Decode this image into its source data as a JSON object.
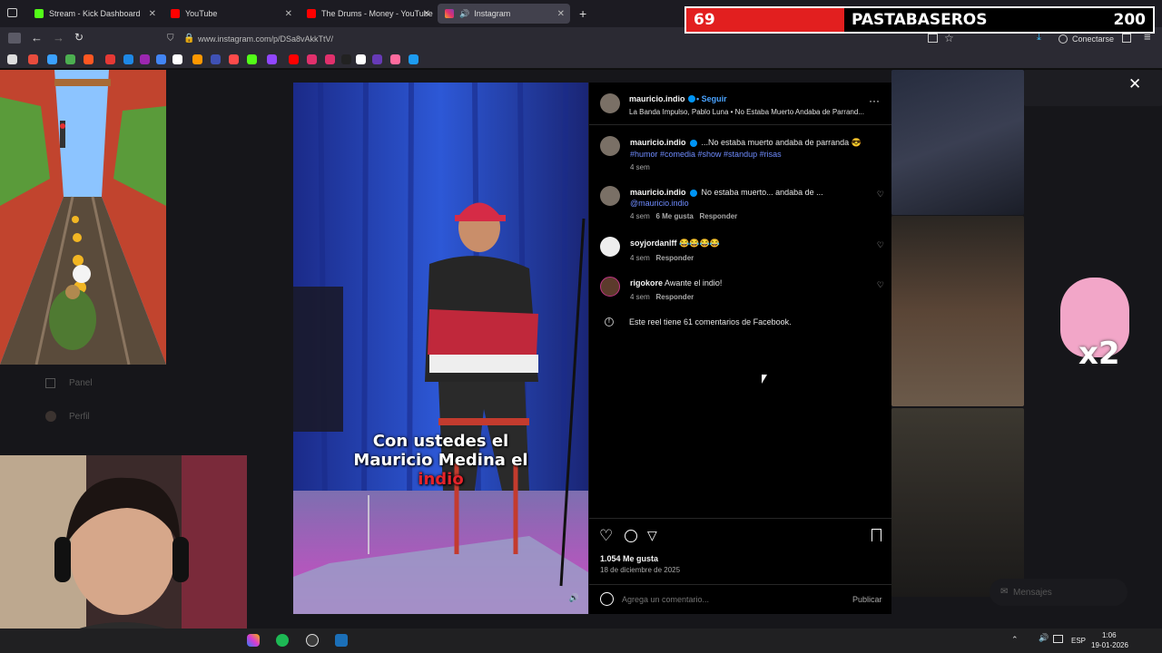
{
  "browser": {
    "tabs": [
      {
        "title": "Stream - Kick Dashboard",
        "color": "#53fc18"
      },
      {
        "title": "YouTube",
        "color": "#ff0000"
      },
      {
        "title": "The Drums - Money - YouTube",
        "color": "#ff0000"
      },
      {
        "title": "Instagram",
        "color": "#e1306c"
      }
    ],
    "url": "www.instagram.com/p/DSa8vAkkTtV/",
    "connect_label": "Conectarse"
  },
  "score_overlay": {
    "left_score": "69",
    "team_name": "PASTABASEROS",
    "right_score": "200"
  },
  "sidebar": {
    "items": [
      {
        "label": "Panel"
      },
      {
        "label": "Perfil"
      }
    ]
  },
  "post": {
    "author": "mauricio.indio",
    "follow_label": "Seguir",
    "audio_line": "La Banda Impulso, Pablo Luna • No Estaba Muerto Andaba de Parrand...",
    "video_caption_line1": "Con ustedes el",
    "video_caption_line2": "Mauricio Medina el",
    "video_caption_line3": "indio",
    "caption": {
      "user": "mauricio.indio",
      "text": "...No estaba muerto andaba de parranda 😎",
      "hashtags": "#humor #comedia #show #standup #risas",
      "time": "4 sem"
    },
    "comments": [
      {
        "user": "mauricio.indio",
        "text": "No estaba muerto... andaba de ...",
        "mention": "@mauricio.indio",
        "time": "4 sem",
        "likes": "6 Me gusta",
        "reply": "Responder"
      },
      {
        "user": "soyjordanlff",
        "text": "😂😂😂😂",
        "time": "4 sem",
        "reply": "Responder"
      },
      {
        "user": "rigokore",
        "text": "Awante el indio!",
        "time": "4 sem",
        "reply": "Responder"
      }
    ],
    "facebook_note": "Este reel tiene 61 comentarios de Facebook.",
    "likes": "1.054 Me gusta",
    "date": "18 de diciembre de 2025",
    "comment_placeholder": "Agrega un comentario...",
    "publish_label": "Publicar"
  },
  "messages_label": "Mensajes",
  "sticker_label": "x2",
  "taskbar": {
    "lang": "ESP",
    "time": "1:06",
    "date": "19-01-2026"
  }
}
